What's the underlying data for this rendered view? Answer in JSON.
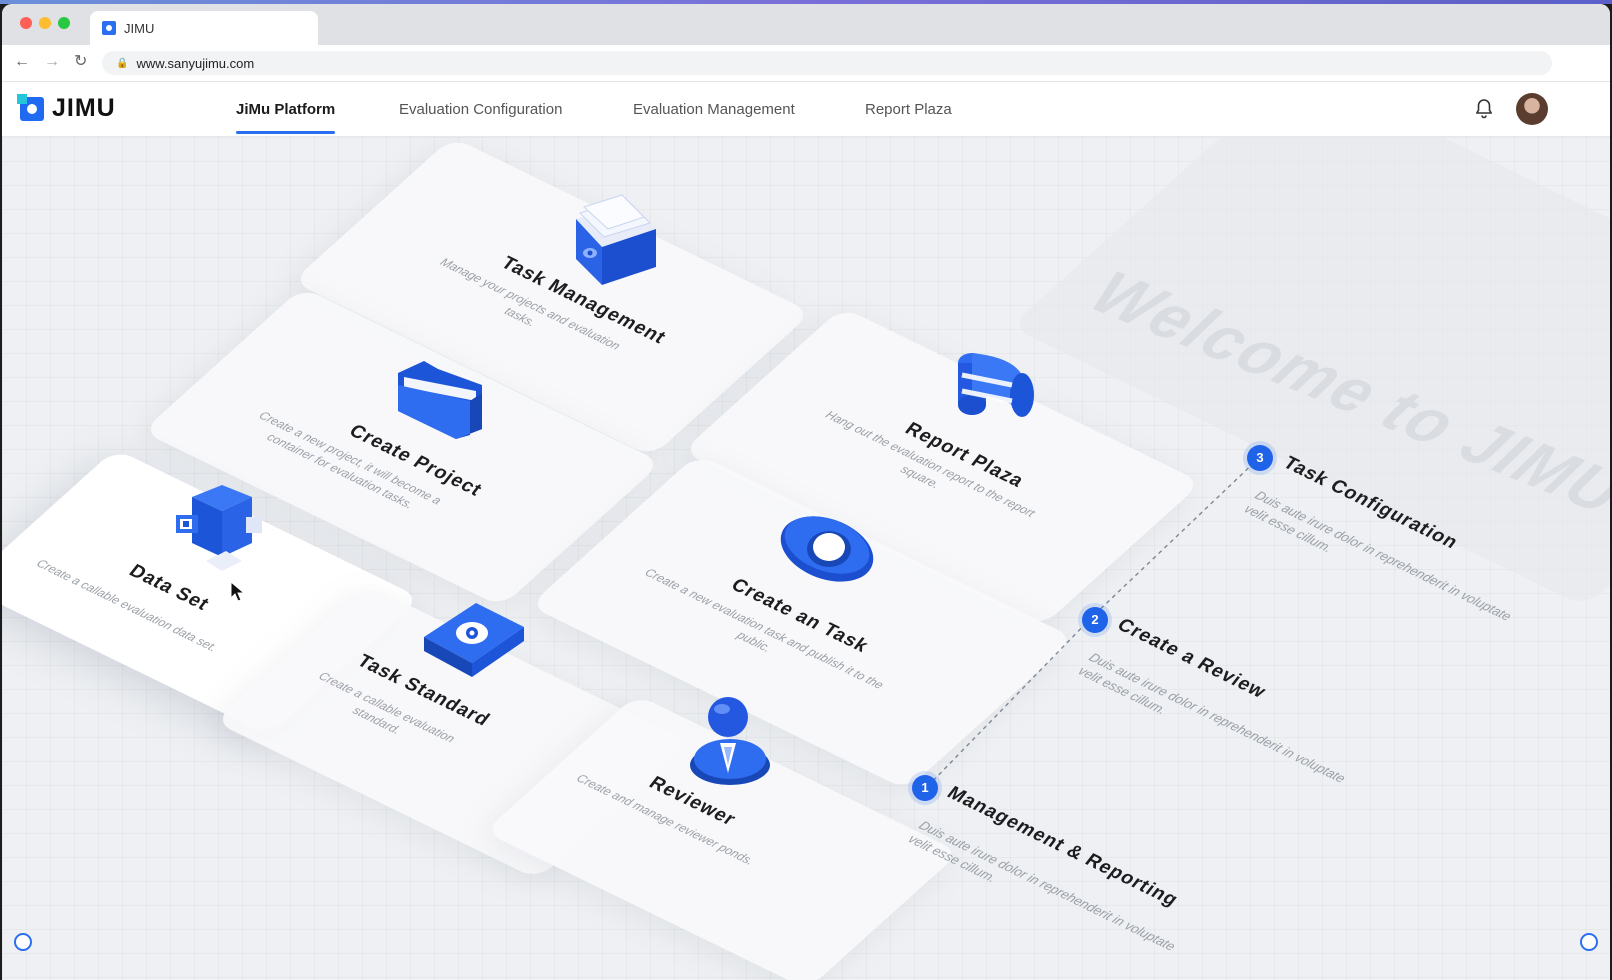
{
  "browser": {
    "tab_title": "JIMU",
    "url": "www.sanyujimu.com",
    "traffic_lights": {
      "close": "#ff5f57",
      "minimize": "#febc2e",
      "maximize": "#28c840"
    }
  },
  "header": {
    "logo_text": "JIMU",
    "nav": [
      {
        "label": "JiMu Platform",
        "active": true
      },
      {
        "label": "Evaluation Configuration",
        "active": false
      },
      {
        "label": "Evaluation Management",
        "active": false
      },
      {
        "label": "Report Plaza",
        "active": false
      }
    ],
    "icons": {
      "notifications": "bell-icon",
      "user": "avatar"
    }
  },
  "welcome_text": "Welcome to JIMU",
  "cards": {
    "task_management": {
      "title": "Task Management",
      "desc": "Manage your projects and evaluation tasks.",
      "icon": "file-drawer-icon"
    },
    "create_project": {
      "title": "Create Project",
      "desc": "Create a new project, it will become a container for evaluation tasks.",
      "icon": "folder-icon"
    },
    "report_plaza": {
      "title": "Report Plaza",
      "desc": "Hang out the evaluation report to the report square.",
      "icon": "scroll-icon"
    },
    "data_set": {
      "title": "Data Set",
      "desc": "Create a callable evaluation data set.",
      "icon": "data-cube-icon"
    },
    "create_task": {
      "title": "Create an Task",
      "desc": "Create a new evaluation task and publish it to the public.",
      "icon": "eye-icon"
    },
    "task_standard": {
      "title": "Task Standard",
      "desc": "Create a callable evaluation standard.",
      "icon": "eye-folder-icon"
    },
    "reviewer": {
      "title": "Reviewer",
      "desc": "Create and manage reviewer ponds.",
      "icon": "person-icon"
    }
  },
  "steps": [
    {
      "number": "1",
      "title": "Management & Reporting",
      "desc": "Duis aute irure dolor in reprehenderit in voluptate velit esse cillum."
    },
    {
      "number": "2",
      "title": "Create a Review",
      "desc": "Duis aute irure dolor in reprehenderit in voluptate velit esse cillum."
    },
    {
      "number": "3",
      "title": "Task Configuration",
      "desc": "Duis aute irure dolor in reprehenderit in voluptate velit esse cillum."
    }
  ],
  "colors": {
    "accent": "#2b6ef2",
    "icon_blue": "#1f5ee8",
    "badge": "#1f63e9"
  }
}
